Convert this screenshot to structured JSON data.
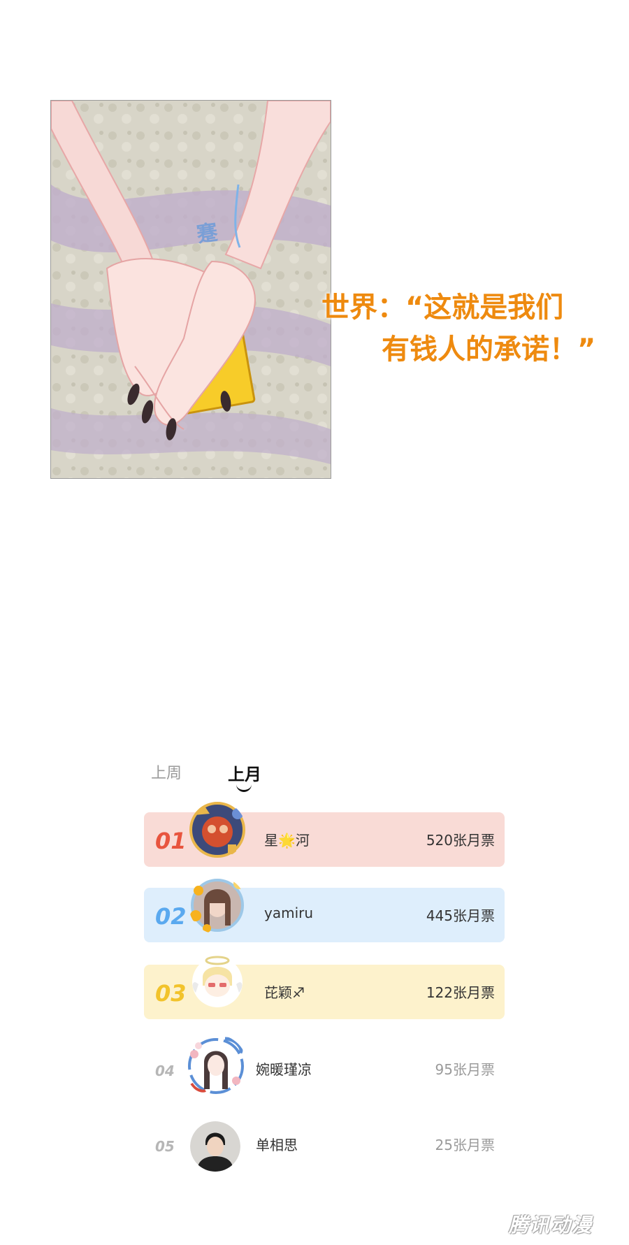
{
  "panel": {
    "sfx": "蹇",
    "caption_line1": "世界：“这就是我们",
    "caption_line2": "有钱人的承诺！”"
  },
  "ranking": {
    "tabs": [
      "上周",
      "上月"
    ],
    "active_tab": "上月",
    "rows": [
      {
        "rank": "01",
        "name": "星🌟河",
        "votes": "520张月票",
        "color": "#f9dbd6",
        "accent": "#e8543e"
      },
      {
        "rank": "02",
        "name": "yamiru",
        "votes": "445张月票",
        "color": "#deeefc",
        "accent": "#5aa9ef"
      },
      {
        "rank": "03",
        "name": "芘颖♐",
        "votes": "122张月票",
        "color": "#fdf2cc",
        "accent": "#f2c32b"
      },
      {
        "rank": "04",
        "name": "婉暖瑾凉",
        "votes": "95张月票",
        "color": "#ffffff",
        "accent": "#b6b6b6"
      },
      {
        "rank": "05",
        "name": "单相思",
        "votes": "25张月票",
        "color": "#ffffff",
        "accent": "#b6b6b6"
      }
    ]
  },
  "watermark": "腾讯动漫"
}
